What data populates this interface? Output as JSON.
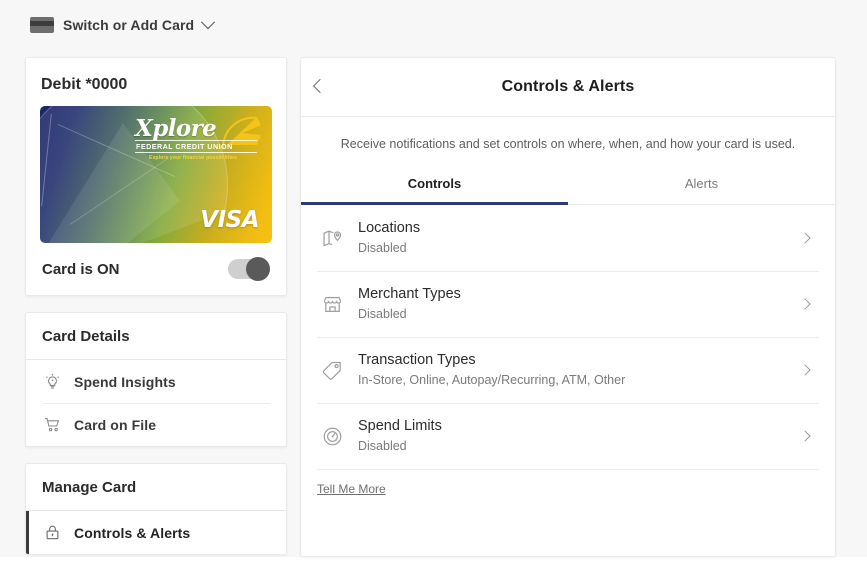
{
  "topbar": {
    "card_icon": "credit-card-icon",
    "switch_label": "Switch or Add Card",
    "chevron": "chevron-down-icon"
  },
  "card_panel": {
    "title": "Debit *0000",
    "art": {
      "brand_wordmark": "Xplore",
      "brand_sub": "FEDERAL CREDIT UNION",
      "brand_tagline": "Explore your financial possibilities",
      "network": "VISA",
      "gradient_start": "#1b2566",
      "gradient_mid": "#84aa3b",
      "gradient_end": "#f5c211"
    },
    "state_label": "Card is ON",
    "toggle_state": "on"
  },
  "sections": [
    {
      "heading": "Card Details",
      "items": [
        {
          "label": "Spend Insights",
          "icon": "lightbulb-icon",
          "active": false
        },
        {
          "label": "Card on File",
          "icon": "shopping-cart-icon",
          "active": false
        }
      ]
    },
    {
      "heading": "Manage Card",
      "items": [
        {
          "label": "Controls & Alerts",
          "icon": "lock-icon",
          "active": true
        }
      ]
    }
  ],
  "detail": {
    "back_icon": "chevron-left-icon",
    "title": "Controls & Alerts",
    "description": "Receive notifications and set controls on where, when, and how your card is used.",
    "tabs": [
      {
        "label": "Controls",
        "active": true
      },
      {
        "label": "Alerts",
        "active": false
      }
    ],
    "active_tab_color": "#2d3c78",
    "controls": [
      {
        "title": "Locations",
        "subtitle": "Disabled",
        "icon": "map-pin-icon"
      },
      {
        "title": "Merchant Types",
        "subtitle": "Disabled",
        "icon": "storefront-icon"
      },
      {
        "title": "Transaction Types",
        "subtitle": "In-Store, Online, Autopay/Recurring, ATM, Other",
        "icon": "price-tag-icon"
      },
      {
        "title": "Spend Limits",
        "subtitle": "Disabled",
        "icon": "speedometer-icon"
      }
    ],
    "tell_me_more": "Tell Me More"
  }
}
